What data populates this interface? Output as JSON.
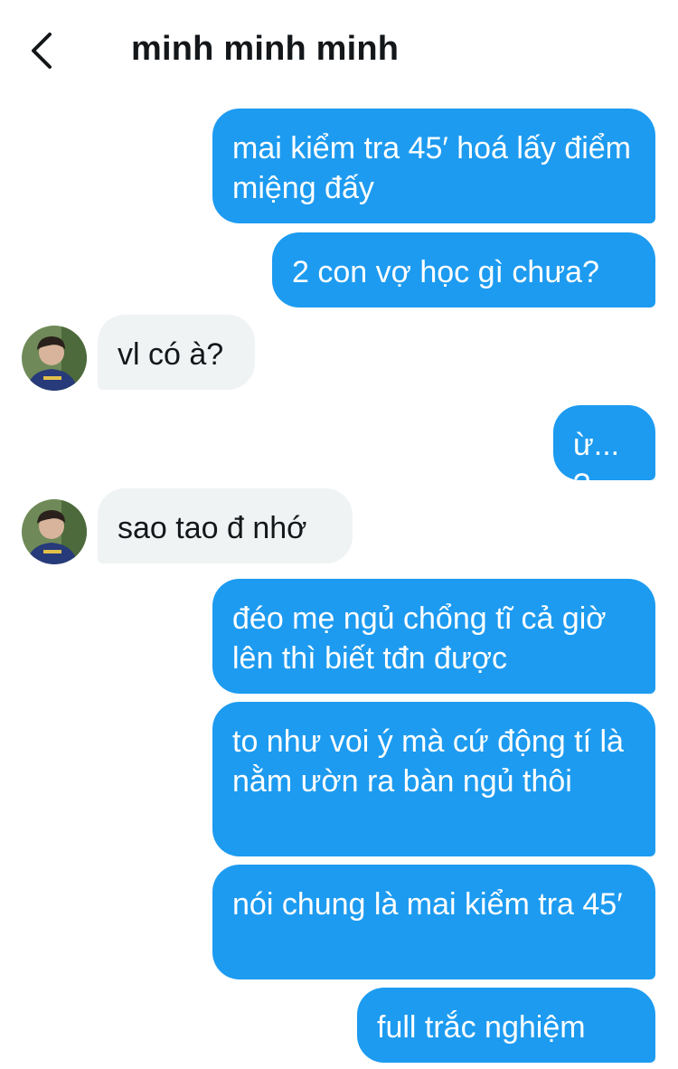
{
  "header": {
    "back_icon": "chevron-left-icon",
    "contact_name": "minh minh minh"
  },
  "messages": [
    {
      "direction": "outgoing",
      "text": "mai kiểm tra 45′ hoá lấy điểm miệng đấy"
    },
    {
      "direction": "outgoing",
      "text": "2 con vợ học gì chưa?"
    },
    {
      "direction": "incoming",
      "text": "vl có à?"
    },
    {
      "direction": "outgoing",
      "text": "ừ...?"
    },
    {
      "direction": "incoming",
      "text": "sao tao đ nhớ"
    },
    {
      "direction": "outgoing",
      "text": "đéo mẹ ngủ chổng tĩ cả giờ lên thì biết tđn được"
    },
    {
      "direction": "outgoing",
      "text": "to như voi ý mà cứ động tí là nằm ườn ra bàn ngủ thôi"
    },
    {
      "direction": "outgoing",
      "text": "nói chung là mai kiểm tra 45′"
    },
    {
      "direction": "outgoing",
      "text": "full trắc nghiệm"
    }
  ],
  "colors": {
    "outgoing_bubble": "#1d9bf0",
    "incoming_bubble": "#eff3f4",
    "outgoing_text": "#ffffff",
    "incoming_text": "#14171a"
  }
}
